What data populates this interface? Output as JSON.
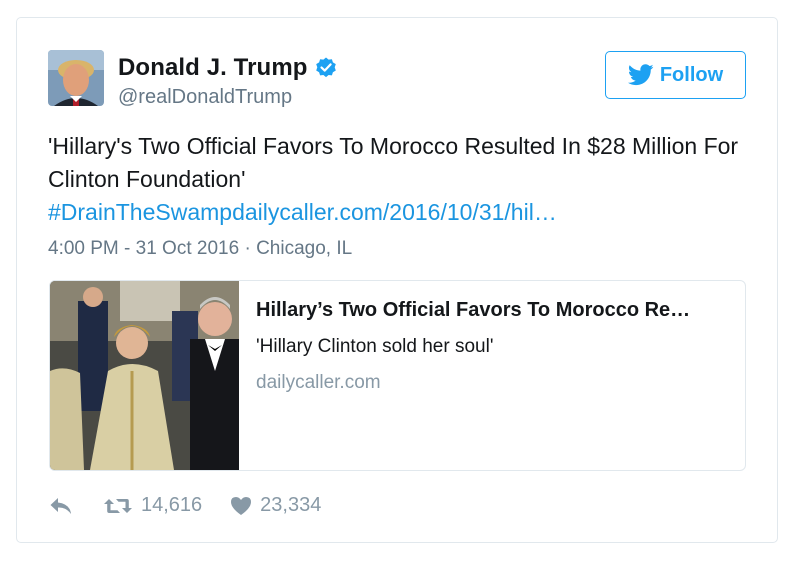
{
  "user": {
    "display_name": "Donald J. Trump",
    "handle": "@realDonaldTrump",
    "verified": true
  },
  "follow_button": {
    "label": "Follow"
  },
  "tweet": {
    "text": "'Hillary's Two Official Favors To Morocco Resulted In $28 Million For Clinton Foundation'",
    "link_text": "#DrainTheSwampdailycaller.com/2016/10/31/hil…",
    "timestamp": "4:00 PM - 31 Oct 2016",
    "separator": " · ",
    "location": "Chicago, IL"
  },
  "link_card": {
    "title": "Hillary’s Two Official Favors To Morocco Re…",
    "description": "'Hillary Clinton sold her soul'",
    "domain": "dailycaller.com"
  },
  "actions": {
    "retweet_count": "14,616",
    "like_count": "23,334"
  },
  "colors": {
    "accent": "#1da1f2",
    "link": "#1b95e0",
    "muted": "#657786",
    "icon": "#8899a6",
    "border": "#e1e8ed"
  }
}
